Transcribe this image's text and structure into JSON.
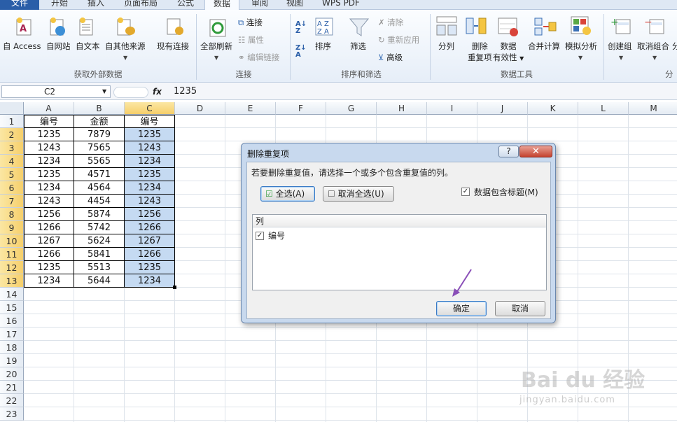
{
  "tabs": [
    "文件",
    "开始",
    "插入",
    "页面布局",
    "公式",
    "数据",
    "审阅",
    "视图",
    "WPS PDF"
  ],
  "ribbon": {
    "get_external": {
      "buttons": [
        "自 Access",
        "自网站",
        "自文本",
        "自其他来源",
        "现有连接"
      ],
      "group": "获取外部数据"
    },
    "connections": {
      "refresh_all": "全部刷新",
      "items": [
        "连接",
        "属性",
        "编辑链接"
      ],
      "group": "连接"
    },
    "sort_filter": {
      "sort": "排序",
      "filter": "筛选",
      "items": [
        "清除",
        "重新应用",
        "高级"
      ],
      "group": "排序和筛选"
    },
    "data_tools": {
      "split": "分列",
      "remove_dup_1": "删除",
      "remove_dup_2": "重复项",
      "validation_1": "数据",
      "validation_2": "有效性",
      "consolidate": "合并计算",
      "what_if": "模拟分析",
      "group": "数据工具"
    },
    "outline": {
      "group_btn": "创建组",
      "ungroup_btn": "取消组合",
      "subtotal_partial": "分",
      "group": "分"
    }
  },
  "formula_bar": {
    "name_box": "C2",
    "fx": "fx",
    "value": "1235"
  },
  "columns": [
    "A",
    "B",
    "C",
    "D",
    "E",
    "F",
    "G",
    "H",
    "I",
    "J",
    "K",
    "L",
    "M"
  ],
  "rows": [
    "1",
    "2",
    "3",
    "4",
    "5",
    "6",
    "7",
    "8",
    "9",
    "10",
    "11",
    "12",
    "13",
    "14",
    "15",
    "16",
    "17",
    "18",
    "19",
    "20",
    "21",
    "22",
    "23"
  ],
  "cells": {
    "headers": [
      "编号",
      "金额",
      "编号"
    ],
    "data": [
      [
        "1235",
        "7879",
        "1235"
      ],
      [
        "1243",
        "7565",
        "1243"
      ],
      [
        "1234",
        "5565",
        "1234"
      ],
      [
        "1235",
        "4571",
        "1235"
      ],
      [
        "1234",
        "4564",
        "1234"
      ],
      [
        "1243",
        "4454",
        "1243"
      ],
      [
        "1256",
        "5874",
        "1256"
      ],
      [
        "1266",
        "5742",
        "1266"
      ],
      [
        "1267",
        "5624",
        "1267"
      ],
      [
        "1266",
        "5841",
        "1266"
      ],
      [
        "1235",
        "5513",
        "1235"
      ],
      [
        "1234",
        "5644",
        "1234"
      ]
    ]
  },
  "dialog": {
    "title": "删除重复项",
    "help": "?",
    "close": "✕",
    "instruction": "若要删除重复值，请选择一个或多个包含重复值的列。",
    "select_all": "全选(A)",
    "unselect_all": "取消全选(U)",
    "has_headers": "数据包含标题(M)",
    "column_header": "列",
    "columns": [
      "编号"
    ],
    "ok": "确定",
    "cancel": "取消"
  },
  "colors": {
    "accent": "#2a5ea8",
    "selection": "#c5daf2",
    "header_selected": "#f6cf6b",
    "arrow": "#8a4fb8"
  },
  "watermark": {
    "brand": "Bai du 经验",
    "url": "jingyan.baidu.com"
  }
}
